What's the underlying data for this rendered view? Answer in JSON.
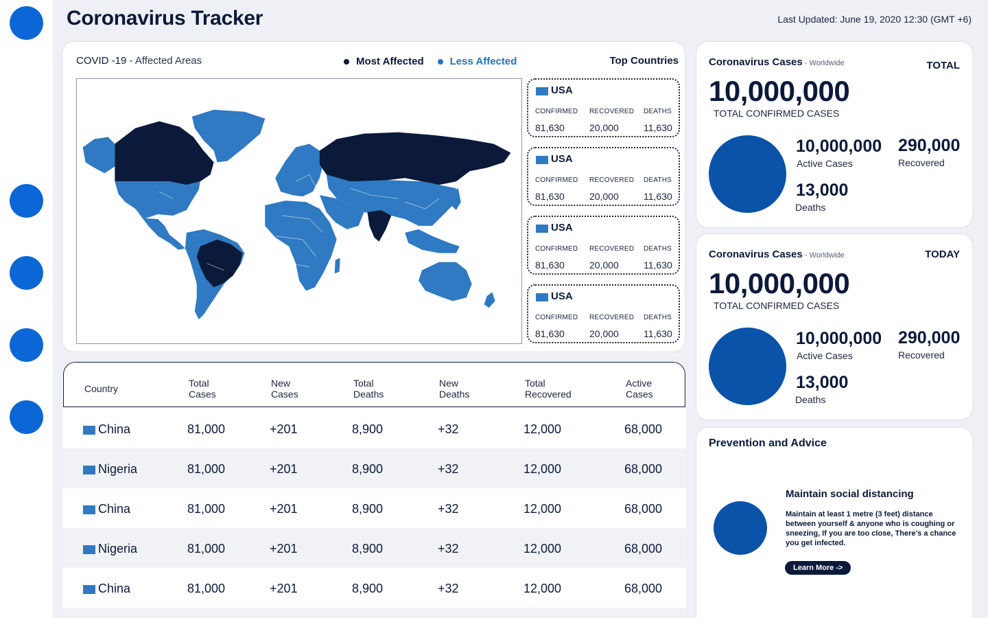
{
  "header": {
    "title": "Coronavirus Tracker",
    "last_updated": "Last Updated: June 19, 2020 12:30 (GMT +6)"
  },
  "colors": {
    "accent": "#0b66d6",
    "most_affected": "#0b1a3a",
    "less_affected": "#2f7ac2",
    "circle": "#0a53a8"
  },
  "sidebar": {
    "nav_icons": [
      "nav-icon-logo",
      "nav-icon-1",
      "nav-icon-2",
      "nav-icon-3",
      "nav-icon-4"
    ]
  },
  "map_panel": {
    "title_main": "COVID -19",
    "title_sub": " - Affected Areas",
    "legend": {
      "most": "Most Affected",
      "less": "Less Affected"
    },
    "top_countries_label": "Top Countries",
    "countries": [
      {
        "name": "USA",
        "confirmed_label": "CONFIRMED",
        "recovered_label": "RECOVERED",
        "deaths_label": "DEATHS",
        "confirmed": "81,630",
        "recovered": "20,000",
        "deaths": "11,630"
      },
      {
        "name": "USA",
        "confirmed_label": "CONFIRMED",
        "recovered_label": "RECOVERED",
        "deaths_label": "DEATHS",
        "confirmed": "81,630",
        "recovered": "20,000",
        "deaths": "11,630"
      },
      {
        "name": "USA",
        "confirmed_label": "CONFIRMED",
        "recovered_label": "RECOVERED",
        "deaths_label": "DEATHS",
        "confirmed": "81,630",
        "recovered": "20,000",
        "deaths": "11,630"
      },
      {
        "name": "USA",
        "confirmed_label": "CONFIRMED",
        "recovered_label": "RECOVERED",
        "deaths_label": "DEATHS",
        "confirmed": "81,630",
        "recovered": "20,000",
        "deaths": "11,630"
      }
    ]
  },
  "table": {
    "headers": {
      "country": "Country",
      "total_cases": [
        "Total",
        "Cases"
      ],
      "new_cases": [
        "New",
        "Cases"
      ],
      "total_deaths": [
        "Total",
        "Deaths"
      ],
      "new_deaths": [
        "New",
        "Deaths"
      ],
      "total_recovered": [
        "Total",
        "Recovered"
      ],
      "active_cases": [
        "Active",
        "Cases"
      ]
    },
    "rows": [
      {
        "country": "China",
        "total_cases": "81,000",
        "new_cases": "+201",
        "total_deaths": "8,900",
        "new_deaths": "+32",
        "total_recovered": "12,000",
        "active_cases": "68,000"
      },
      {
        "country": "Nigeria",
        "total_cases": "81,000",
        "new_cases": "+201",
        "total_deaths": "8,900",
        "new_deaths": "+32",
        "total_recovered": "12,000",
        "active_cases": "68,000"
      },
      {
        "country": "China",
        "total_cases": "81,000",
        "new_cases": "+201",
        "total_deaths": "8,900",
        "new_deaths": "+32",
        "total_recovered": "12,000",
        "active_cases": "68,000"
      },
      {
        "country": "Nigeria",
        "total_cases": "81,000",
        "new_cases": "+201",
        "total_deaths": "8,900",
        "new_deaths": "+32",
        "total_recovered": "12,000",
        "active_cases": "68,000"
      },
      {
        "country": "China",
        "total_cases": "81,000",
        "new_cases": "+201",
        "total_deaths": "8,900",
        "new_deaths": "+32",
        "total_recovered": "12,000",
        "active_cases": "68,000"
      }
    ]
  },
  "stats": [
    {
      "title": "Coronavirus Cases",
      "subtitle": " - Worldwide",
      "badge": "TOTAL",
      "confirmed": "10,000,000",
      "confirmed_label": "TOTAL CONFIRMED CASES",
      "active": "10,000,000",
      "active_label": "Active Cases",
      "recovered": "290,000",
      "recovered_label": "Recovered",
      "deaths": "13,000",
      "deaths_label": "Deaths"
    },
    {
      "title": "Coronavirus Cases",
      "subtitle": " - Worldwide",
      "badge": "TODAY",
      "confirmed": "10,000,000",
      "confirmed_label": "TOTAL CONFIRMED CASES",
      "active": "10,000,000",
      "active_label": "Active Cases",
      "recovered": "290,000",
      "recovered_label": "Recovered",
      "deaths": "13,000",
      "deaths_label": "Deaths"
    }
  ],
  "advice": {
    "title": "Prevention and Advice",
    "heading": "Maintain social distancing",
    "body": "Maintain at least 1 metre (3 feet) distance between yourself & anyone who is coughing or sneezing, If you are too close, There's a chance you get infected.",
    "button": "Learn More  ->"
  }
}
